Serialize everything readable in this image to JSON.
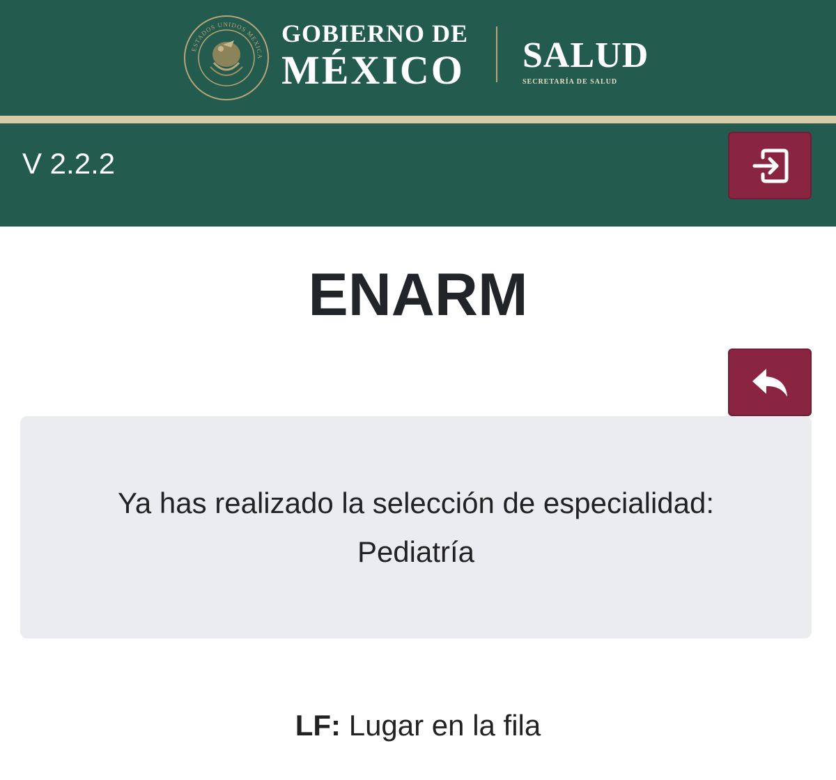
{
  "header": {
    "gov_line1": "GOBIERNO DE",
    "gov_line2": "MÉXICO",
    "salud_title": "SALUD",
    "salud_subtitle": "SECRETARÍA DE SALUD",
    "seal_text": "ESTADOS UNIDOS MEXICANOS",
    "colors": {
      "primary_green": "#235b4e",
      "gold": "#d9cba5",
      "maroon": "#8a2541"
    }
  },
  "navbar": {
    "version": "V 2.2.2",
    "logout_icon": "logout-icon"
  },
  "main": {
    "title": "ENARM",
    "back_icon": "reply-arrow-icon",
    "message_line1": "Ya has realizado la selección de especialidad:",
    "message_line2": "Pediatría",
    "legend_abbr": "LF:",
    "legend_text": "Lugar en la fila"
  }
}
